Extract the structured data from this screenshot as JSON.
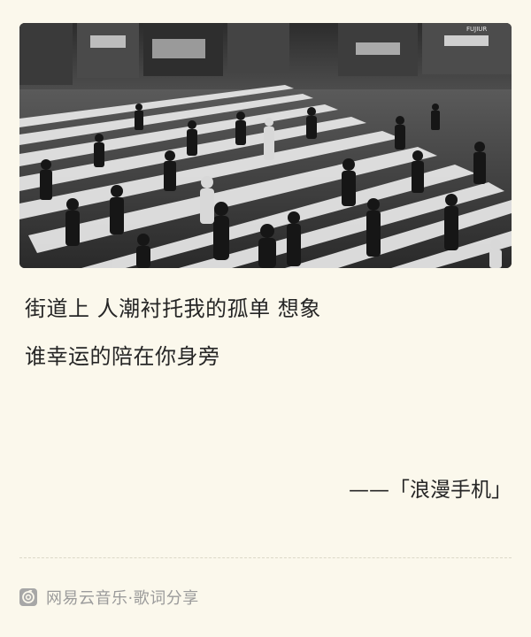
{
  "lyrics": [
    "街道上 人潮衬托我的孤单 想象",
    "谁幸运的陪在你身旁"
  ],
  "source": {
    "prefix": "——",
    "title": "「浪漫手机」"
  },
  "footer": {
    "icon": "netease-cloud-music-icon",
    "text": "网易云音乐·歌词分享"
  },
  "photo": {
    "icon": "street-crossing-photo",
    "sign_text": "FUJIUR"
  }
}
